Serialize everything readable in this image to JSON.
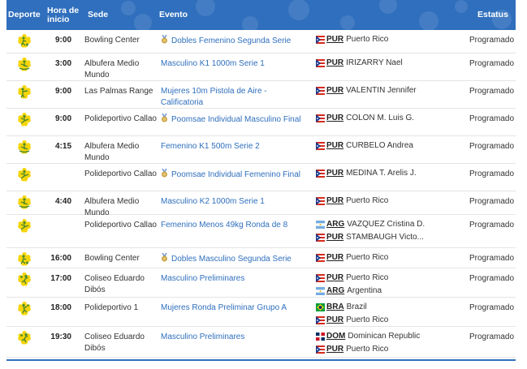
{
  "header": {
    "deporte": "Deporte",
    "hora": "Hora de inicio",
    "sede": "Sede",
    "evento": "Evento",
    "estatus": "Estatus"
  },
  "colors": {
    "header_bg": "#2f6fbd",
    "link": "#2f6fbd",
    "sport_icon_yellow": "#f5d50a",
    "gold_medal": "#c9a245"
  },
  "rows": [
    {
      "sport_icon": "bowling-icon",
      "hora": "9:00",
      "sede": "Bowling Center",
      "evento": "Dobles Femenino Segunda Serie",
      "medal": true,
      "participants": [
        {
          "flag": "PUR",
          "code": "PUR",
          "name": "Puerto Rico"
        }
      ],
      "estatus": "Programado"
    },
    {
      "sport_icon": "canoe-icon",
      "hora": "3:00",
      "sede": "Albufera Medio Mundo",
      "evento": "Masculino K1 1000m Serie 1",
      "medal": false,
      "participants": [
        {
          "flag": "PUR",
          "code": "PUR",
          "name": "IRIZARRY Nael"
        }
      ],
      "estatus": "Programado"
    },
    {
      "sport_icon": "shooting-icon",
      "hora": "9:00",
      "sede": "Las Palmas Range",
      "evento": "Mujeres 10m Pistola de Aire - Calificatoria",
      "medal": false,
      "participants": [
        {
          "flag": "PUR",
          "code": "PUR",
          "name": "VALENTIN Jennifer"
        }
      ],
      "estatus": "Programado"
    },
    {
      "sport_icon": "taekwondo-icon",
      "hora": "9:00",
      "sede": "Polideportivo Callao",
      "evento": "Poomsae Individual Masculino Final",
      "medal": true,
      "participants": [
        {
          "flag": "PUR",
          "code": "PUR",
          "name": "COLON M. Luis G."
        }
      ],
      "estatus": "Programado"
    },
    {
      "sport_icon": "canoe-icon",
      "hora": "4:15",
      "sede": "Albufera Medio Mundo",
      "evento": "Femenino K1 500m Serie 2",
      "medal": false,
      "participants": [
        {
          "flag": "PUR",
          "code": "PUR",
          "name": "CURBELO Andrea"
        }
      ],
      "estatus": "Programado"
    },
    {
      "sport_icon": "taekwondo-icon",
      "hora": "",
      "sede": "Polideportivo Callao",
      "evento": "Poomsae Individual Femenino Final",
      "medal": true,
      "participants": [
        {
          "flag": "PUR",
          "code": "PUR",
          "name": "MEDINA T. Arelis J."
        }
      ],
      "estatus": "Programado"
    },
    {
      "sport_icon": "canoe-icon",
      "hora": "4:40",
      "sede": "Albufera Medio Mundo",
      "evento": "Masculino K2 1000m Serie 1",
      "medal": false,
      "participants": [
        {
          "flag": "PUR",
          "code": "PUR",
          "name": "Puerto Rico"
        }
      ],
      "estatus": "Programado"
    },
    {
      "sport_icon": "taekwondo-icon",
      "hora": "",
      "sede": "Polideportivo Callao",
      "evento": "Femenino Menos 49kg Ronda de 8",
      "medal": false,
      "participants": [
        {
          "flag": "ARG",
          "code": "ARG",
          "name": "VAZQUEZ Cristina D."
        },
        {
          "flag": "PUR",
          "code": "PUR",
          "name": "STAMBAUGH Victo..."
        }
      ],
      "estatus": "Programado"
    },
    {
      "sport_icon": "bowling-icon",
      "hora": "16:00",
      "sede": "Bowling Center",
      "evento": "Dobles Masculino Segunda Serie",
      "medal": true,
      "participants": [
        {
          "flag": "PUR",
          "code": "PUR",
          "name": "Puerto Rico"
        }
      ],
      "estatus": "Programado"
    },
    {
      "sport_icon": "volleyball-icon",
      "hora": "17:00",
      "sede": "Coliseo Eduardo Dibós",
      "evento": "Masculino Preliminares",
      "medal": false,
      "participants": [
        {
          "flag": "PUR",
          "code": "PUR",
          "name": "Puerto Rico"
        },
        {
          "flag": "ARG",
          "code": "ARG",
          "name": "Argentina"
        }
      ],
      "estatus": "Programado"
    },
    {
      "sport_icon": "handball-icon",
      "hora": "18:00",
      "sede": "Polideportivo 1",
      "evento": "Mujeres Ronda Preliminar Grupo A",
      "medal": false,
      "participants": [
        {
          "flag": "BRA",
          "code": "BRA",
          "name": "Brazil"
        },
        {
          "flag": "PUR",
          "code": "PUR",
          "name": "Puerto Rico"
        }
      ],
      "estatus": "Programado"
    },
    {
      "sport_icon": "volleyball-icon",
      "hora": "19:30",
      "sede": "Coliseo Eduardo Dibós",
      "evento": "Masculino Preliminares",
      "medal": false,
      "participants": [
        {
          "flag": "DOM",
          "code": "DOM",
          "name": "Dominican Republic"
        },
        {
          "flag": "PUR",
          "code": "PUR",
          "name": "Puerto Rico"
        }
      ],
      "estatus": "Programado"
    }
  ]
}
